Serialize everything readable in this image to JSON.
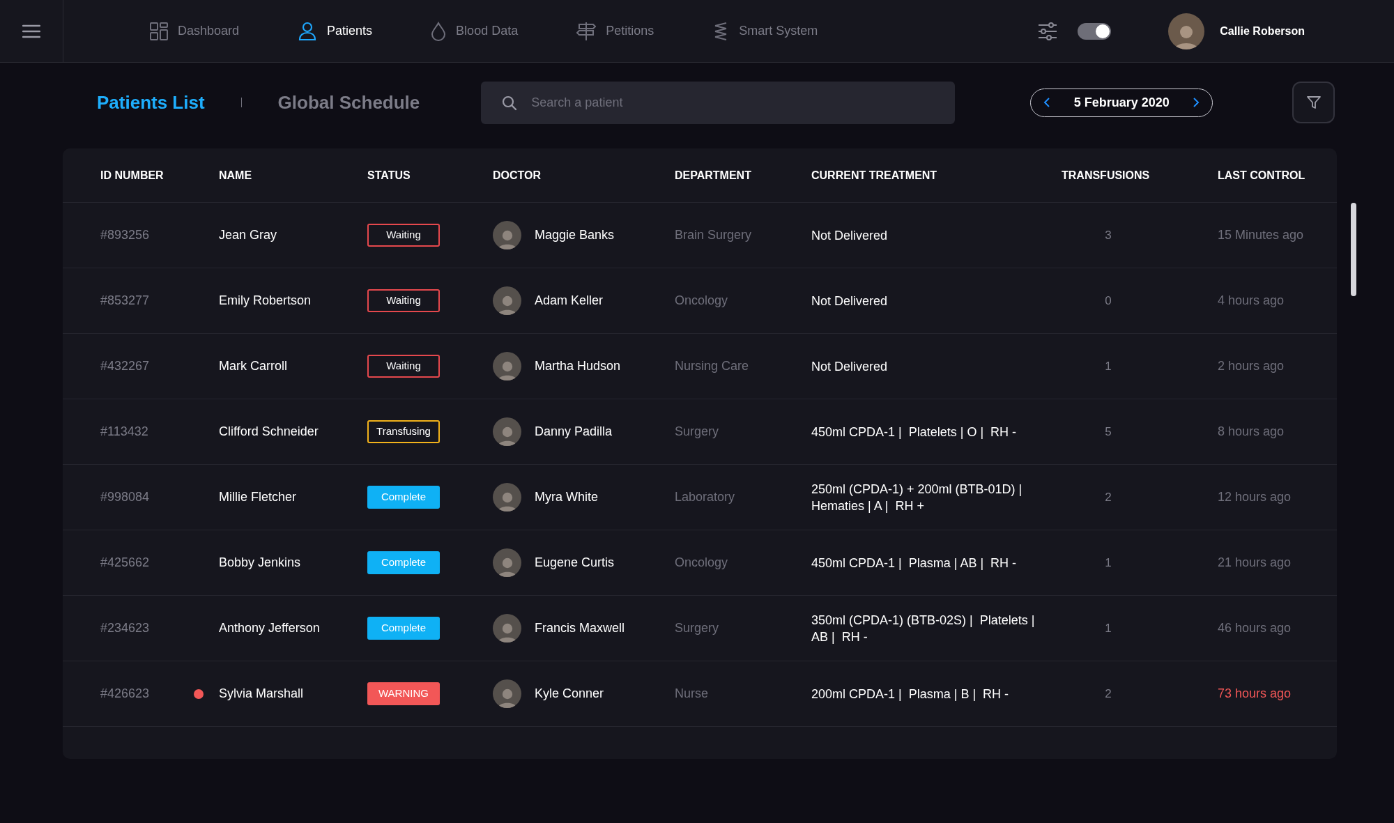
{
  "nav": {
    "items": [
      {
        "label": "Dashboard",
        "kind": "dashboard",
        "selected": false
      },
      {
        "label": "Patients",
        "kind": "patients",
        "selected": true
      },
      {
        "label": "Blood Data",
        "kind": "blood",
        "selected": false
      },
      {
        "label": "Petitions",
        "kind": "petitions",
        "selected": false
      },
      {
        "label": "Smart System",
        "kind": "system",
        "selected": false
      }
    ],
    "toggle": {
      "on": true
    },
    "user": {
      "name": "Callie Roberson"
    }
  },
  "tabs": [
    {
      "label": "Patients List",
      "selected": true
    },
    {
      "label": "Global Schedule",
      "selected": false
    }
  ],
  "search": {
    "placeholder": "Search a patient"
  },
  "date": {
    "label": "5 February 2020"
  },
  "table": {
    "columns": [
      "ID NUMBER",
      "NAME",
      "STATUS",
      "DOCTOR",
      "DEPARTMENT",
      "CURRENT TREATMENT",
      "TRANSFUSIONS",
      "LAST CONTROL"
    ],
    "rows": [
      {
        "id": "#893256",
        "name": "Jean Gray",
        "alert": false,
        "status": {
          "label": "Waiting",
          "kind": "waiting"
        },
        "doctor": "Maggie Banks",
        "department": "Brain Surgery",
        "treatment": "Not Delivered",
        "transfusions": "3",
        "last_control": "15 Minutes ago"
      },
      {
        "id": "#853277",
        "name": "Emily Robertson",
        "alert": false,
        "status": {
          "label": "Waiting",
          "kind": "waiting"
        },
        "doctor": "Adam Keller",
        "department": "Oncology",
        "treatment": "Not Delivered",
        "transfusions": "0",
        "last_control": "4 hours ago"
      },
      {
        "id": "#432267",
        "name": "Mark Carroll",
        "alert": false,
        "status": {
          "label": "Waiting",
          "kind": "waiting"
        },
        "doctor": "Martha Hudson",
        "department": "Nursing Care",
        "treatment": "Not Delivered",
        "transfusions": "1",
        "last_control": "2 hours ago"
      },
      {
        "id": "#113432",
        "name": "Clifford Schneider",
        "alert": false,
        "status": {
          "label": "Transfusing",
          "kind": "transfusing"
        },
        "doctor": "Danny Padilla",
        "department": "Surgery",
        "treatment": "450ml CPDA-1 |  Platelets | O |  RH -",
        "transfusions": "5",
        "last_control": "8 hours ago"
      },
      {
        "id": "#998084",
        "name": "Millie Fletcher",
        "alert": false,
        "status": {
          "label": "Complete",
          "kind": "complete"
        },
        "doctor": "Myra White",
        "department": "Laboratory",
        "treatment": "250ml (CPDA-1) + 200ml (BTB-01D) | Hematies | A |  RH +",
        "transfusions": "2",
        "last_control": "12 hours ago"
      },
      {
        "id": "#425662",
        "name": "Bobby Jenkins",
        "alert": false,
        "status": {
          "label": "Complete",
          "kind": "complete"
        },
        "doctor": "Eugene Curtis",
        "department": "Oncology",
        "treatment": "450ml CPDA-1 |  Plasma | AB |  RH -",
        "transfusions": "1",
        "last_control": "21 hours ago"
      },
      {
        "id": "#234623",
        "name": "Anthony Jefferson",
        "alert": false,
        "status": {
          "label": "Complete",
          "kind": "complete"
        },
        "doctor": "Francis Maxwell",
        "department": "Surgery",
        "treatment": "350ml (CPDA-1) (BTB-02S) |  Platelets | AB |  RH -",
        "transfusions": "1",
        "last_control": "46 hours ago"
      },
      {
        "id": "#426623",
        "name": "Sylvia Marshall",
        "alert": true,
        "status": {
          "label": "WARNING",
          "kind": "warning"
        },
        "doctor": "Kyle Conner",
        "department": "Nurse",
        "treatment": "200ml CPDA-1 |  Plasma | B |  RH -",
        "transfusions": "2",
        "last_control": "73 hours ago"
      }
    ]
  }
}
